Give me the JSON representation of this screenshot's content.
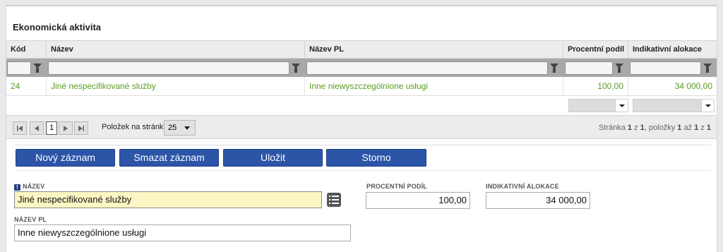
{
  "section_title": "Ekonomická aktivita",
  "grid": {
    "columns": [
      "Kód",
      "Název",
      "Název PL",
      "Procentní podíl",
      "Indikativní alokace"
    ],
    "rows": [
      {
        "kod": "24",
        "nazev": "Jiné nespecifikované služby",
        "nazev_pl": "Inne niewyszczególnione usługi",
        "podil": "100,00",
        "alokace": "34 000,00"
      }
    ]
  },
  "pager": {
    "current_page": "1",
    "page_size_label": "Položek na stránku",
    "page_size": "25",
    "info_prefix": "Stránka ",
    "info_page": "1",
    "info_of": " z ",
    "info_total_pages": "1",
    "info_items": ", položky ",
    "info_from": "1",
    "info_to_word": " až ",
    "info_to": "1",
    "info_z": " z ",
    "info_count": "1"
  },
  "buttons": {
    "new": "Nový záznam",
    "delete": "Smazat záznam",
    "save": "Uložit",
    "cancel": "Storno"
  },
  "form": {
    "nazev_label": "NÁZEV",
    "nazev_value": "Jiné nespecifikované služby",
    "nazev_pl_label": "NÁZEV PL",
    "nazev_pl_value": "Inne niewyszczególnione usługi",
    "podil_label": "PROCENTNÍ PODÍL",
    "podil_value": "100,00",
    "alokace_label": "INDIKATIVNÍ ALOKACE",
    "alokace_value": "34 000,00",
    "required_mark": "!"
  },
  "colors": {
    "accent_button": "#2c55a8",
    "row_text": "#5a9e22",
    "required_field": "#fbf6c3"
  }
}
